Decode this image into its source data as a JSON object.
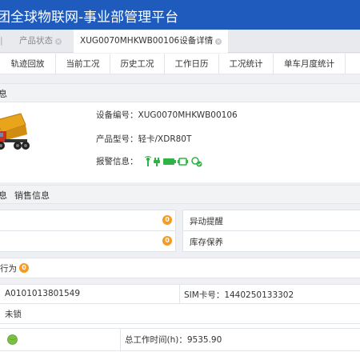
{
  "header": {
    "title": "团全球物联网-事业部管理平台"
  },
  "tabs": {
    "partial_sep": "|",
    "product_status": "产品状态",
    "device_detail": "XUG0070MHKWB00106设备详情",
    "close_glyph": "×"
  },
  "subnav": [
    "轨迹回放",
    "当前工况",
    "历史工况",
    "工作日历",
    "工况统计",
    "单车月度统计"
  ],
  "basic_section": {
    "label_partial": "息"
  },
  "device": {
    "device_no": "设备编号：XUG0070MHKWB00106",
    "product_model": "产品型号：轻卡/XDR80T",
    "alarm_label": "报警信息：",
    "alarm_icons": [
      "antenna-icon",
      "plug-icon",
      "battery-icon",
      "connector-icon",
      "satellite-check-icon"
    ]
  },
  "sales_section": {
    "tab_partial": "息",
    "tab_sales": "销售信息"
  },
  "status_rows": {
    "row1_count": "0",
    "row1_right": "异动提醒",
    "row2_count": "0",
    "row2_right": "库存保养"
  },
  "behavior": {
    "label": "行为",
    "count": "0"
  },
  "terminal": {
    "terminal_no": "A0101013801549",
    "sim": "SIM卡号：1440250133302",
    "lock_status": "未锁",
    "total_work_time": "总工作时间(h)：9535.90"
  },
  "colors": {
    "header": "#1e5bbd",
    "badge": "#f59a23",
    "alarm_green": "#2fb344",
    "online_green": "#7ac143"
  }
}
